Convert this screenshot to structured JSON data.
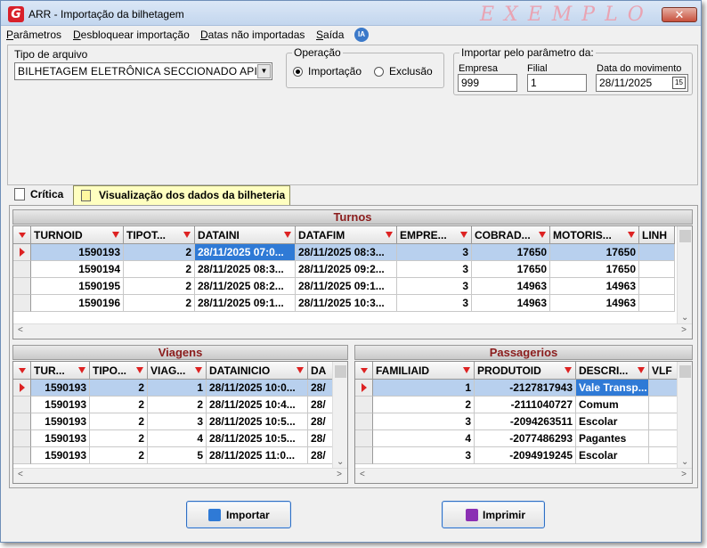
{
  "window": {
    "title": "ARR - Importação da bilhetagem",
    "watermark": "EXEMPLO",
    "close_glyph": "✕"
  },
  "menu": {
    "items": [
      {
        "prefix": "P",
        "rest": "arâmetros"
      },
      {
        "prefix": "D",
        "rest": "esbloquear importação"
      },
      {
        "prefix": "D",
        "rest": "atas não importadas"
      },
      {
        "prefix": "S",
        "rest": "aída"
      }
    ],
    "ia_label": "IA"
  },
  "tipo_arquivo": {
    "label": "Tipo de arquivo",
    "value": "BILHETAGEM ELETRÔNICA SECCIONADO API"
  },
  "operacao": {
    "label": "Operação",
    "options": [
      {
        "label": "Importação",
        "selected": true
      },
      {
        "label": "Exclusão",
        "selected": false
      }
    ]
  },
  "parametro": {
    "label": "Importar pelo parâmetro da:",
    "empresa_label": "Empresa",
    "empresa_value": "999",
    "filial_label": "Filial",
    "filial_value": "1",
    "data_label": "Data do movimento",
    "data_value": "28/11/2025",
    "cal_glyph": "15"
  },
  "tabs": {
    "critica": "Crítica",
    "visualizacao": "Visualização dos dados da bilheteria"
  },
  "turnos": {
    "title": "Turnos",
    "columns": [
      "TURNOID",
      "TIPOT...",
      "DATAINI",
      "DATAFIM",
      "EMPRE...",
      "COBRAD...",
      "MOTORIS...",
      "LINH"
    ],
    "rows": [
      [
        "1590193",
        "2",
        "28/11/2025 07:0...",
        "28/11/2025 08:3...",
        "3",
        "17650",
        "17650",
        ""
      ],
      [
        "1590194",
        "2",
        "28/11/2025 08:3...",
        "28/11/2025 09:2...",
        "3",
        "17650",
        "17650",
        ""
      ],
      [
        "1590195",
        "2",
        "28/11/2025 08:2...",
        "28/11/2025 09:1...",
        "3",
        "14963",
        "14963",
        ""
      ],
      [
        "1590196",
        "2",
        "28/11/2025 09:1...",
        "28/11/2025 10:3...",
        "3",
        "14963",
        "14963",
        ""
      ]
    ]
  },
  "viagens": {
    "title": "Viagens",
    "columns": [
      "TUR...",
      "TIPO...",
      "VIAG...",
      "DATAINICIO",
      "DA"
    ],
    "rows": [
      [
        "1590193",
        "2",
        "1",
        "28/11/2025 10:0...",
        "28/"
      ],
      [
        "1590193",
        "2",
        "2",
        "28/11/2025 10:4...",
        "28/"
      ],
      [
        "1590193",
        "2",
        "3",
        "28/11/2025 10:5...",
        "28/"
      ],
      [
        "1590193",
        "2",
        "4",
        "28/11/2025 10:5...",
        "28/"
      ],
      [
        "1590193",
        "2",
        "5",
        "28/11/2025 11:0...",
        "28/"
      ]
    ]
  },
  "passageiros": {
    "title": "Passagerios",
    "columns": [
      "FAMILIAID",
      "PRODUTOID",
      "DESCRI...",
      "VLF"
    ],
    "rows": [
      [
        "1",
        "-2127817943",
        "Vale Transp...",
        ""
      ],
      [
        "2",
        "-2111040727",
        "Comum",
        ""
      ],
      [
        "3",
        "-2094263511",
        "Escolar",
        ""
      ],
      [
        "4",
        "-2077486293",
        "Pagantes",
        ""
      ],
      [
        "3",
        "-2094919245",
        "Escolar",
        ""
      ]
    ]
  },
  "buttons": {
    "importar": "Importar",
    "imprimir": "Imprimir"
  }
}
